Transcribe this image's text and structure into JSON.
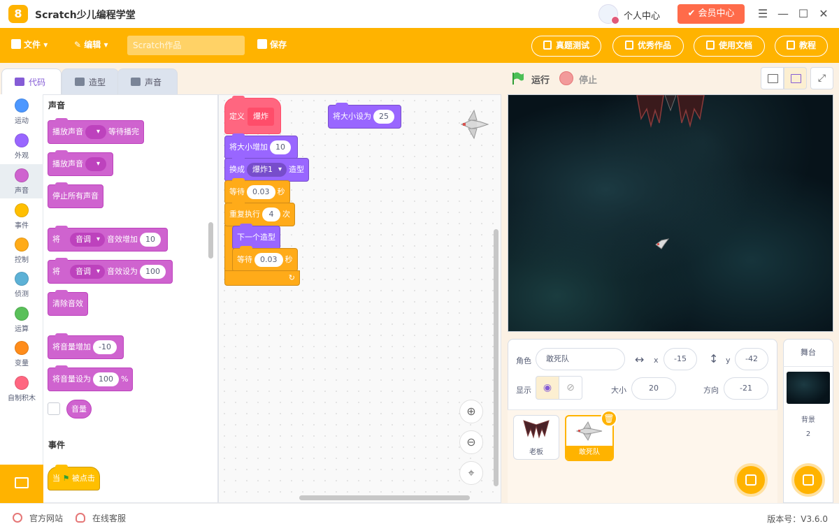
{
  "titlebar": {
    "logo_glyph": "8",
    "app_title": "Scratch少儿编程学堂",
    "user_center": "个人中心",
    "vip_label": "会员中心",
    "vip_color": "#ff6b4a",
    "controls": [
      "menu-icon",
      "minimize-icon",
      "maximize-icon",
      "close-icon"
    ]
  },
  "toolbar": {
    "file": "文件",
    "edit": "编辑",
    "project_placeholder": "Scratch作品",
    "save": "保存",
    "exam": "真题测试",
    "showcase": "优秀作品",
    "docs": "使用文档",
    "tutorial": "教程",
    "accent_color": "#ffb300"
  },
  "tabs": [
    "代码",
    "造型",
    "声音"
  ],
  "categories": [
    {
      "label": "运动",
      "color": "#4c97ff"
    },
    {
      "label": "外观",
      "color": "#9966ff"
    },
    {
      "label": "声音",
      "color": "#cf63cf"
    },
    {
      "label": "事件",
      "color": "#ffbf00"
    },
    {
      "label": "控制",
      "color": "#ffab19"
    },
    {
      "label": "侦测",
      "color": "#5cb1d6"
    },
    {
      "label": "运算",
      "color": "#59c059"
    },
    {
      "label": "变量",
      "color": "#ff8c1a"
    },
    {
      "label": "自制积木",
      "color": "#ff6680"
    }
  ],
  "palette": {
    "sound_title": "声音",
    "events_title": "事件",
    "play_until_done": "播放声音",
    "wait_done": "等待播完",
    "play_sound": "播放声音",
    "stop_all_sounds": "停止所有声音",
    "effect_change_prefix": "将",
    "effect_name": "音调",
    "effect_change_suffix": "音效增加",
    "effect_change_value": "10",
    "effect_set_prefix": "将",
    "effect_set_suffix": "音效设为",
    "effect_set_value": "100",
    "clear_effects": "清除音效",
    "change_volume": "将音量增加",
    "change_volume_value": "-10",
    "set_volume": "将音量设为",
    "set_volume_value": "100",
    "percent": "%",
    "volume_reporter": "音量",
    "when_flag_prefix": "当",
    "when_flag_suffix": "被点击"
  },
  "script": {
    "define_label": "定义",
    "define_name": "爆炸",
    "change_size": "将大小增加",
    "change_size_value": "10",
    "switch_costume": "换成",
    "costume_name": "爆炸1",
    "costume_suffix": "造型",
    "wait1": "等待",
    "wait1_value": "0.03",
    "wait1_unit": "秒",
    "repeat": "重复执行",
    "repeat_value": "4",
    "repeat_unit": "次",
    "next_costume": "下一个造型",
    "wait2": "等待",
    "wait2_value": "0.03",
    "wait2_unit": "秒",
    "set_size": "将大小设为",
    "set_size_value": "25",
    "repeat_arrow": "↻"
  },
  "stage_header": {
    "run": "运行",
    "stop": "停止"
  },
  "sprite_info": {
    "sprite_label": "角色",
    "sprite_name": "敢死队",
    "x_label": "x",
    "x_value": "-15",
    "y_label": "y",
    "y_value": "-42",
    "show_label": "显示",
    "size_label": "大小",
    "size_value": "20",
    "direction_label": "方向",
    "direction_value": "-21"
  },
  "sprites": [
    {
      "name": "老板",
      "icon": "bat-sprite-icon"
    },
    {
      "name": "敢死队",
      "icon": "fighter-jet-sprite-icon"
    }
  ],
  "stage_panel": {
    "title": "舞台",
    "backdrop_label": "背景",
    "backdrop_count": "2"
  },
  "footer": {
    "website": "官方网站",
    "support": "在线客服",
    "version": "版本号：V3.6.0"
  }
}
